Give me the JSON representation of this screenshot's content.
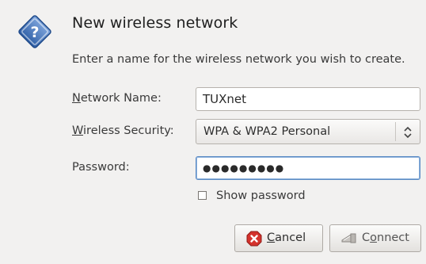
{
  "dialog": {
    "title": "New wireless network",
    "description": "Enter a name for the wireless network you wish to create."
  },
  "form": {
    "network_name": {
      "label_mnemonic": "N",
      "label_rest": "etwork Name:",
      "value": "TUXnet"
    },
    "wireless_security": {
      "label_mnemonic": "W",
      "label_rest": "ireless Security:",
      "selected": "WPA & WPA2 Personal"
    },
    "password": {
      "label": "Password:",
      "masked_value": "●●●●●●●●●"
    },
    "show_password": {
      "label": "Show password",
      "checked": false
    }
  },
  "buttons": {
    "cancel": {
      "mnemonic": "C",
      "rest": "ancel"
    },
    "connect": {
      "pre": "C",
      "mnemonic": "o",
      "rest": "nnect"
    }
  },
  "colors": {
    "accent_focus": "#5b8bc4",
    "question_icon": "#3f6fb3",
    "cancel_icon": "#d4322c"
  },
  "icons": {
    "dialog": "question-icon",
    "cancel": "stop-icon",
    "connect": "wireless-icon",
    "combo": "up-down-arrows-icon"
  }
}
